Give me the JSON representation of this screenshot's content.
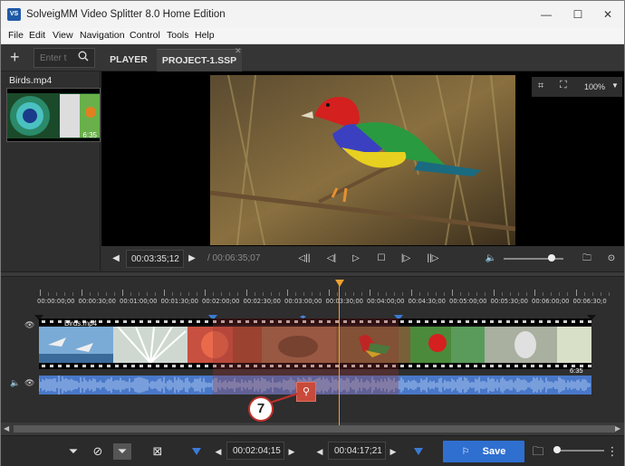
{
  "window": {
    "title": "SolveigMM Video Splitter 8.0 Home Edition",
    "icon_text": "VS",
    "minimize": "—",
    "maximize": "☐",
    "close": "✕"
  },
  "menu": [
    "File",
    "Edit",
    "View",
    "Navigation",
    "Control",
    "Tools",
    "Help"
  ],
  "toolbar": {
    "add": "+",
    "search_placeholder": "Enter t",
    "tabs": [
      {
        "label": "PLAYER",
        "active": false
      },
      {
        "label": "PROJECT-1.SSP",
        "active": true
      }
    ]
  },
  "library": {
    "file_name": "Birds.mp4",
    "thumb_duration": "6:35"
  },
  "preview": {
    "zoom": "100%"
  },
  "transport": {
    "current_time": "00:03:35;12",
    "total_time": "/ 00:06:35;07"
  },
  "timeline": {
    "ticks": [
      "00:00:00;00",
      "00:00:30;00",
      "00:01:00;00",
      "00:01:30;00",
      "00:02:00;00",
      "00:02:30;00",
      "00:03:00;00",
      "00:03:30;00",
      "00:04:00;00",
      "00:04:30;00",
      "00:05:00;00",
      "00:05:30;00",
      "00:06:00;00",
      "00:06:30;0"
    ],
    "track_name": "Birds.mp4",
    "clip_duration": "6:35",
    "callout_number": "7"
  },
  "bottom": {
    "marker_in_time": "00:02:04;15",
    "marker_out_time": "00:04:17;21",
    "save_label": "Save"
  },
  "colors": {
    "accent": "#2f6fd0",
    "playhead": "#f0a030",
    "selection": "#963232",
    "audio": "#4a78c8"
  }
}
